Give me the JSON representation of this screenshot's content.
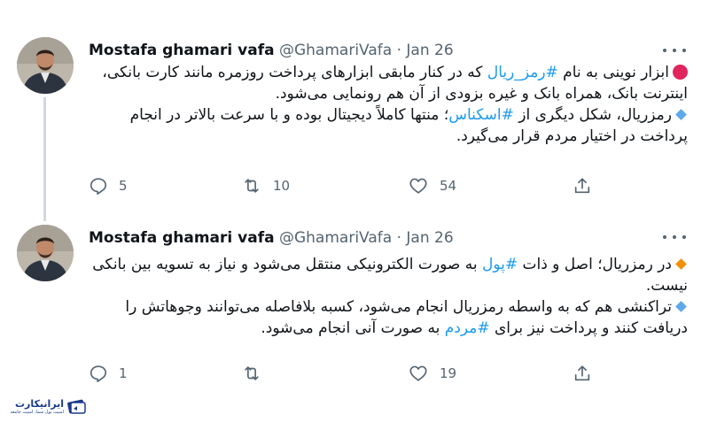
{
  "tweets": [
    {
      "author_name": "Mostafa ghamari vafa",
      "handle": "@GhamariVafa",
      "separator": "·",
      "date": "Jan 26",
      "p1_a": "ابزار نوینی به نام ",
      "p1_tag": "#رمز_ریال",
      "p1_b": " که در کنار مابقی ابزارهای پرداخت روزمره مانند کارت بانکی، اینترنت بانک، همراه بانک و غیره بزودی از آن هم رونمایی می‌شود.",
      "p2_a": "رمزریال، شکل دیگری از ",
      "p2_tag": "#اسکناس",
      "p2_b": "؛ منتها کاملاً دیجیتال بوده و با سرعت بالاتر در انجام پرداخت در اختیار مردم قرار می‌گیرد.",
      "replies": "5",
      "retweets": "10",
      "likes": "54",
      "bullet1_color": "#e0245e",
      "bullet2_color": "#5da9e9"
    },
    {
      "author_name": "Mostafa ghamari vafa",
      "handle": "@GhamariVafa",
      "separator": "·",
      "date": "Jan 26",
      "p1_a": "در رمزریال؛ اصل و ذات ",
      "p1_tag": "#پول",
      "p1_b": " به صورت الکترونیکی منتقل می‌شود و نیاز به تسویه بین بانکی نیست.",
      "p2_a": "تراکنشی هم که به واسطه رمزریال انجام می‌شود، کسبه بلافاصله می‌توانند وجوهاتش را دریافت کنند و پرداخت نیز برای ",
      "p2_tag": "#مردم",
      "p2_b": " به صورت آنی انجام می‌شود.",
      "replies": "1",
      "retweets": "",
      "likes": "19",
      "bullet1_color": "#f4900c",
      "bullet2_color": "#5da9e9"
    }
  ],
  "icons": {
    "reply": "reply-icon",
    "retweet": "retweet-icon",
    "like": "like-icon",
    "share": "share-icon",
    "more": "more-icon"
  },
  "colors": {
    "accent": "#1d9bf0",
    "secondary_text": "#536471",
    "thread_line": "#cfd9de"
  },
  "watermark": {
    "title": "ایرانیکارت",
    "subtitle": "امنیت پول شما، امنیت جامعه"
  }
}
